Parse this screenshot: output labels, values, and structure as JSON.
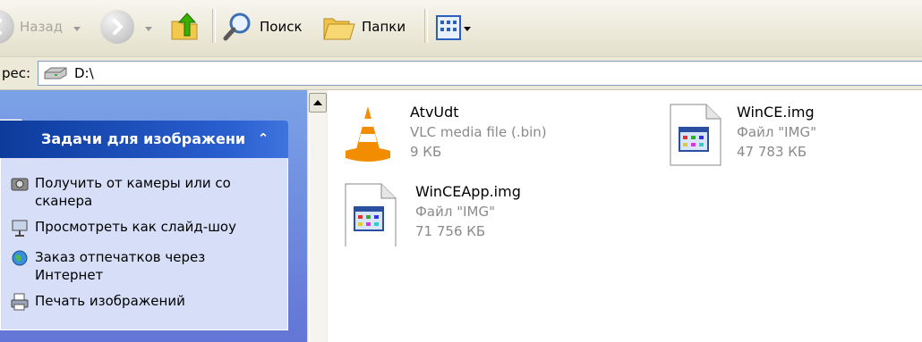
{
  "toolbar": {
    "back_label": "Назад",
    "search_label": "Поиск",
    "folders_label": "Папки"
  },
  "address": {
    "label": "рес:",
    "value": "D:\\"
  },
  "taskpane": {
    "title": "Задачи для изображени",
    "items": [
      {
        "label": "Получить от камеры или со сканера",
        "icon": "camera-icon"
      },
      {
        "label": "Просмотреть как слайд-шоу",
        "icon": "slideshow-icon"
      },
      {
        "label": "Заказ отпечатков через Интернет",
        "icon": "globe-icon"
      },
      {
        "label": "Печать изображений",
        "icon": "printer-icon"
      }
    ]
  },
  "files": [
    {
      "name": "AtvUdt",
      "type": "VLC media file (.bin)",
      "size": "9 КБ",
      "icon": "vlc-cone-icon"
    },
    {
      "name": "WinCE.img",
      "type": "Файл \"IMG\"",
      "size": "47 783 КБ",
      "icon": "img-file-icon"
    },
    {
      "name": "WinCEApp.img",
      "type": "Файл \"IMG\"",
      "size": "71 756 КБ",
      "icon": "img-file-icon"
    }
  ],
  "colors": {
    "toolbar_bg": "#ece9d8",
    "task_header": "#0c3b9c",
    "task_body": "#d6dff7",
    "secondary_text": "#8a8a8a"
  }
}
